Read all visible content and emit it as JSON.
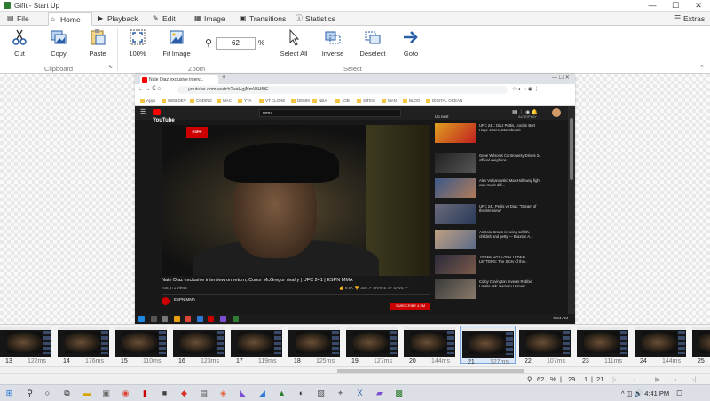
{
  "window": {
    "title": "GifIt - Start Up",
    "controls": [
      "—",
      "☐",
      "✕"
    ]
  },
  "tabs": [
    {
      "label": "File"
    },
    {
      "label": "Home"
    },
    {
      "label": "Playback"
    },
    {
      "label": "Edit"
    },
    {
      "label": "Image"
    },
    {
      "label": "Transitions"
    },
    {
      "label": "Statistics"
    }
  ],
  "extras": "Extras",
  "ribbon": {
    "clipboard": {
      "label": "Clipboard",
      "cut": "Cut",
      "copy": "Copy",
      "paste": "Paste"
    },
    "zoom": {
      "label": "Zoom",
      "p100": "100%",
      "fit": "Fit Image",
      "value": "62",
      "unit": "%"
    },
    "select": {
      "label": "Select",
      "all": "Select All",
      "inverse": "Inverse",
      "deselect": "Deselect",
      "goto": "Goto"
    }
  },
  "browser": {
    "tab_title": "Nate Diaz exclusive interv...",
    "url": "youtube.com/watch?v=HgjNmWHf0E",
    "bookmarks": [
      "Apps",
      "WEB DEV",
      "CODING",
      "MAC",
      "YTA",
      "VT CLONE",
      "DEMM",
      "NBA",
      "JOB",
      "SITES",
      "MAN",
      "BLOG",
      "DIGITAL OCEAN"
    ]
  },
  "youtube": {
    "search": "mma",
    "video_title": "Nate Diaz exclusive interview on return, Conor McGregor rivalry | UFC 241 | ESPN MMA",
    "views": "708,871 views",
    "channel": "ESPN MMA",
    "subscribe": "SUBSCRIBE 4.3M",
    "up_next": "Up next",
    "autoplay": "AUTOPLAY",
    "side": [
      "UFC 241: Diaz Pettis, Jordan Burt Hope-Jones, Stormbrook",
      "Gene Wilson's Controversy Drives 24 official weigh-ins",
      "Alex Volkanovski: Max Holloway fight was much diff...",
      "UFC 241 Pettis vs Diaz: \"Dream of the interview\"",
      "Antonio Brown is being selfish, childish and petty — Braxton A...",
      "THREE DAYS AND THREE LETTERS: The Story of the...",
      "Colby Covington reveals Robbie Lawler ask: Kamaru Usman..."
    ],
    "clock": "9:04 AM"
  },
  "frames": [
    {
      "num": "13",
      "delay": "122ms"
    },
    {
      "num": "14",
      "delay": "176ms"
    },
    {
      "num": "15",
      "delay": "110ms"
    },
    {
      "num": "16",
      "delay": "123ms"
    },
    {
      "num": "17",
      "delay": "119ms"
    },
    {
      "num": "18",
      "delay": "125ms"
    },
    {
      "num": "19",
      "delay": "127ms"
    },
    {
      "num": "20",
      "delay": "144ms"
    },
    {
      "num": "21",
      "delay": "127ms"
    },
    {
      "num": "22",
      "delay": "107ms"
    },
    {
      "num": "23",
      "delay": "111ms"
    },
    {
      "num": "24",
      "delay": "144ms"
    },
    {
      "num": "25",
      "delay": ""
    }
  ],
  "selected_frame": "21",
  "status": {
    "zoom": "62",
    "pct": "%",
    "total": "29",
    "selected": "1",
    "current": "21"
  },
  "taskbar": {
    "time": "4:41 PM"
  }
}
